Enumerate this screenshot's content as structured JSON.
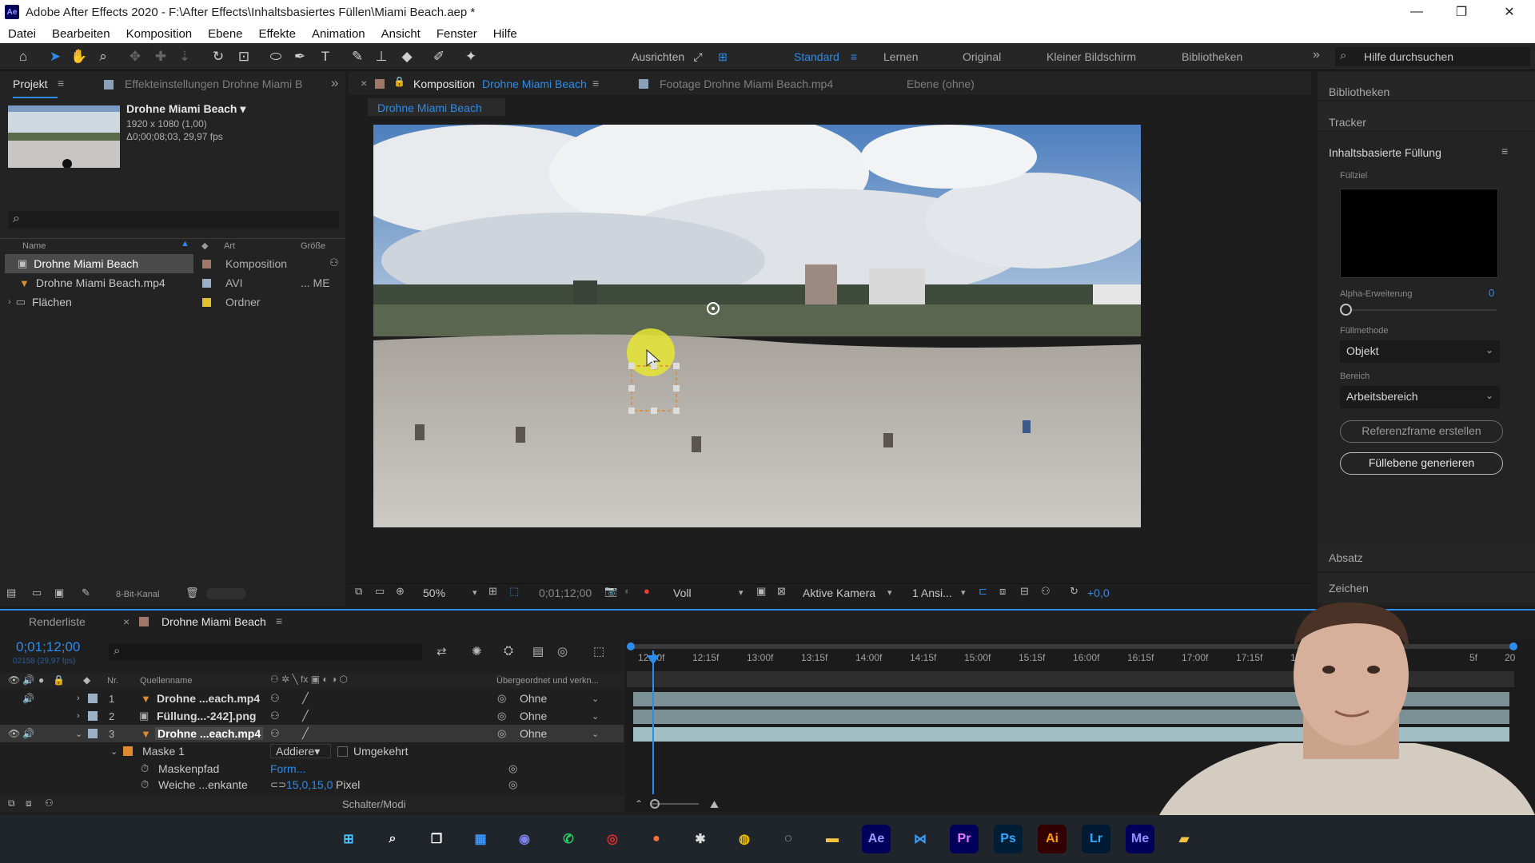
{
  "window": {
    "app_badge": "Ae",
    "title": "Adobe After Effects 2020 - F:\\After Effects\\Inhaltsbasiertes Füllen\\Miami Beach.aep *",
    "minimize": "—",
    "maximize": "❐",
    "close": "✕"
  },
  "menu": [
    "Datei",
    "Bearbeiten",
    "Komposition",
    "Ebene",
    "Effekte",
    "Animation",
    "Ansicht",
    "Fenster",
    "Hilfe"
  ],
  "toolbar": {
    "align_label": "Ausrichten",
    "workspaces": [
      "Standard",
      "Lernen",
      "Original",
      "Kleiner Bildschirm",
      "Bibliotheken"
    ],
    "active_workspace": "Standard",
    "more": "»",
    "search_placeholder": "Hilfe durchsuchen"
  },
  "project_panel": {
    "tab_project": "Projekt",
    "tab_effects": "Effekteinstellungen  Drohne Miami B",
    "more": "»",
    "preview_title": "Drohne Miami Beach ▾",
    "preview_size": "1920 x 1080 (1,00)",
    "preview_duration": "Δ0;00;08;03, 29,97 fps",
    "search_icon": "⌕",
    "col_name": "Name",
    "col_type": "Art",
    "col_size": "Größe",
    "items": [
      {
        "name": "Drohne Miami Beach",
        "type": "Komposition",
        "size": "",
        "swatch": "#a0786a"
      },
      {
        "name": "Drohne Miami Beach.mp4",
        "type": "AVI",
        "size": "... ME",
        "swatch": "#9ab0c8"
      },
      {
        "name": "Flächen",
        "type": "Ordner",
        "size": "",
        "swatch": "#e0c030"
      }
    ],
    "bit_depth": "8-Bit-Kanal"
  },
  "comp_panel": {
    "close": "×",
    "tab_prefix": "Komposition",
    "tab_comp": "Drohne Miami Beach",
    "tab_footage": "Footage  Drohne Miami Beach.mp4",
    "tab_layer": "Ebene (ohne)",
    "breadcrumb": "Drohne Miami Beach",
    "zoom": "50%",
    "timecode": "0;01;12;00",
    "resolution": "Voll",
    "camera": "Aktive Kamera",
    "views": "1 Ansi...",
    "exposure": "+0,0"
  },
  "right_panel": {
    "libraries": "Bibliotheken",
    "tracker": "Tracker",
    "cf_title": "Inhaltsbasierte Füllung",
    "fill_target": "Füllziel",
    "alpha_label": "Alpha-Erweiterung",
    "alpha_value": "0",
    "fill_method_label": "Füllmethode",
    "fill_method_value": "Objekt",
    "range_label": "Bereich",
    "range_value": "Arbeitsbereich",
    "ref_button": "Referenzframe erstellen",
    "gen_button": "Füllebene generieren",
    "paragraph": "Absatz",
    "character": "Zeichen"
  },
  "timeline": {
    "tab_render": "Renderliste",
    "close": "×",
    "tab_comp": "Drohne Miami Beach",
    "timecode": "0;01;12;00",
    "frames": "02158 (29,97 fps)",
    "col_nr": "Nr.",
    "col_source": "Quellenname",
    "col_parent": "Übergeordnet und verkn...",
    "layers": [
      {
        "nr": "1",
        "name": "Drohne ...each.mp4",
        "parent": "Ohne"
      },
      {
        "nr": "2",
        "name": "Füllung...-242].png",
        "parent": "Ohne"
      },
      {
        "nr": "3",
        "name": "Drohne ...each.mp4",
        "parent": "Ohne"
      }
    ],
    "mask_name": "Maske 1",
    "mask_mode": "Addiere▾",
    "mask_inverted": "Umgekehrt",
    "mask_path_label": "Maskenpfad",
    "mask_path_value": "Form...",
    "feather_label": "Weiche ...enkante",
    "feather_value": "15,0,15,0",
    "feather_unit": "Pixel",
    "switches": "Schalter/Modi",
    "ruler": [
      "12:00f",
      "12:15f",
      "13:00f",
      "13:15f",
      "14:00f",
      "14:15f",
      "15:00f",
      "15:15f",
      "16:00f",
      "16:15f",
      "17:00f",
      "17:15f",
      "18:00f",
      "18",
      "5f",
      "20"
    ]
  },
  "taskbar": {
    "apps": [
      {
        "name": "start-icon",
        "label": "⊞",
        "bg": "#20252c",
        "fg": "#4cc2ff"
      },
      {
        "name": "search-icon",
        "label": "⌕",
        "bg": "#20252c",
        "fg": "#ffffff"
      },
      {
        "name": "task-view-icon",
        "label": "❐",
        "bg": "#20252c",
        "fg": "#ffffff"
      },
      {
        "name": "widgets-icon",
        "label": "▦",
        "bg": "#20252c",
        "fg": "#3a96ff"
      },
      {
        "name": "teams-icon",
        "label": "◉",
        "bg": "#20252c",
        "fg": "#7b83eb"
      },
      {
        "name": "whatsapp-icon",
        "label": "✆",
        "bg": "#20252c",
        "fg": "#25d366"
      },
      {
        "name": "recorder-icon",
        "label": "◎",
        "bg": "#20252c",
        "fg": "#e0302a"
      },
      {
        "name": "firefox-icon",
        "label": "●",
        "bg": "#20252c",
        "fg": "#ff7139"
      },
      {
        "name": "tool-icon",
        "label": "✱",
        "bg": "#20252c",
        "fg": "#dddddd"
      },
      {
        "name": "chrome-icon",
        "label": "◍",
        "bg": "#20252c",
        "fg": "#f0c000"
      },
      {
        "name": "davinci-icon",
        "label": "◌",
        "bg": "#20252c",
        "fg": "#dddddd"
      },
      {
        "name": "explorer-icon",
        "label": "▬",
        "bg": "#20252c",
        "fg": "#f5c542"
      },
      {
        "name": "after-effects-icon",
        "label": "Ae",
        "bg": "#00005b",
        "fg": "#9999ff"
      },
      {
        "name": "vscode-icon",
        "label": "⋈",
        "bg": "#20252c",
        "fg": "#3aa0ff"
      },
      {
        "name": "premiere-icon",
        "label": "Pr",
        "bg": "#00005b",
        "fg": "#ea77ff"
      },
      {
        "name": "photoshop-icon",
        "label": "Ps",
        "bg": "#001e36",
        "fg": "#31a8ff"
      },
      {
        "name": "illustrator-icon",
        "label": "Ai",
        "bg": "#330000",
        "fg": "#ff9a00"
      },
      {
        "name": "lightroom-icon",
        "label": "Lr",
        "bg": "#001a33",
        "fg": "#31a8ff"
      },
      {
        "name": "media-encoder-icon",
        "label": "Me",
        "bg": "#00005b",
        "fg": "#8f8fff"
      },
      {
        "name": "folder-icon",
        "label": "▰",
        "bg": "#20252c",
        "fg": "#f5c542"
      }
    ]
  },
  "colors": {
    "accent": "#2d8ceb",
    "panel": "#232323",
    "dark": "#1d1d1d"
  }
}
